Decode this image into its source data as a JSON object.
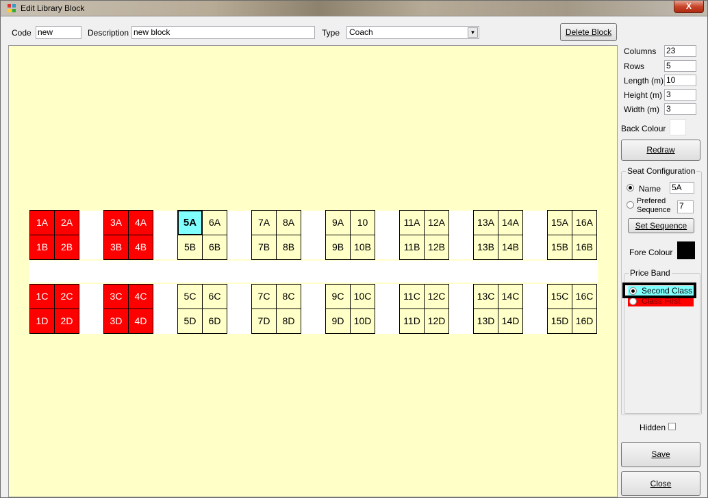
{
  "window": {
    "title": "Edit Library Block",
    "close_label": "X"
  },
  "header": {
    "code_label": "Code",
    "code_value": "new",
    "description_label": "Description",
    "description_value": "new block",
    "type_label": "Type",
    "type_value": "Coach",
    "delete_label": "Delete Block"
  },
  "props": {
    "columns_label": "Columns",
    "columns_value": "23",
    "rows_label": "Rows",
    "rows_value": "5",
    "length_label": "Length (m)",
    "length_value": "10",
    "height_label": "Height (m)",
    "height_value": "3",
    "width_label": "Width (m)",
    "width_value": "3",
    "back_colour_label": "Back Colour",
    "back_colour": "#ffffff",
    "redraw_label": "Redraw"
  },
  "seat_config": {
    "title": "Seat Configuration",
    "name_label": "Name",
    "name_value": "5A",
    "seq_label_1": "Prefered",
    "seq_label_2": "Sequence",
    "seq_value": "7",
    "set_sequence_label": "Set Sequence",
    "fore_colour_label": "Fore Colour",
    "fore_colour": "#000000"
  },
  "price_band": {
    "title": "Price Band",
    "options": [
      {
        "label": "Second Class",
        "selected": true,
        "color": "#80ffff"
      },
      {
        "label": "Class First",
        "selected": false,
        "color": "#ff0000"
      }
    ]
  },
  "hidden_label": "Hidden",
  "save_label": "Save",
  "close_label": "Close",
  "colors": {
    "canvas": "#ffffc8",
    "first_class": "#ff0000",
    "selected": "#80ffff"
  },
  "seat_rows": [
    [
      "1A",
      "2A",
      "3A",
      "4A",
      "5A",
      "6A",
      "7A",
      "8A",
      "9A",
      "10",
      "11A",
      "12A",
      "13A",
      "14A",
      "15A",
      "16A"
    ],
    [
      "1B",
      "2B",
      "3B",
      "4B",
      "5B",
      "6B",
      "7B",
      "8B",
      "9B",
      "10B",
      "11B",
      "12B",
      "13B",
      "14B",
      "15B",
      "16B"
    ],
    [
      "1C",
      "2C",
      "3C",
      "4C",
      "5C",
      "6C",
      "7C",
      "8C",
      "9C",
      "10C",
      "11C",
      "12C",
      "13C",
      "14C",
      "15C",
      "16C"
    ],
    [
      "1D",
      "2D",
      "3D",
      "4D",
      "5D",
      "6D",
      "7D",
      "8D",
      "9D",
      "10D",
      "11D",
      "12D",
      "13D",
      "14D",
      "15D",
      "16D"
    ]
  ],
  "first_class_pairs": 2,
  "selected_seat": "5A"
}
